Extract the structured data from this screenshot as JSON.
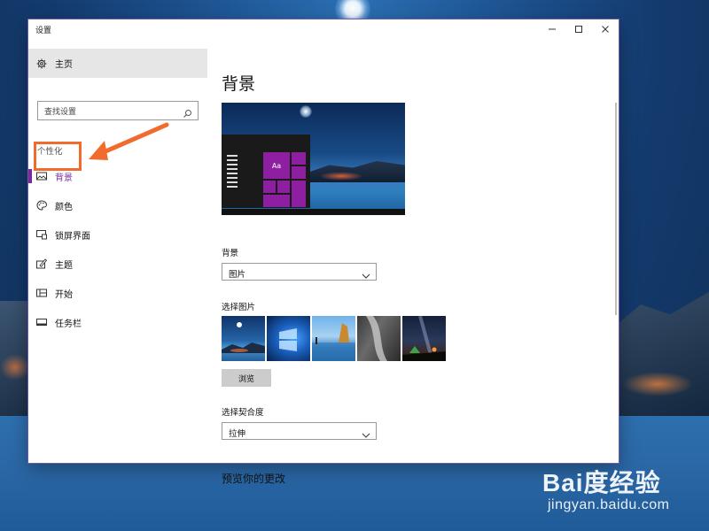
{
  "window": {
    "title": "设置"
  },
  "sidebar": {
    "home_label": "主页",
    "search_placeholder": "查找设置",
    "section_heading": "个性化",
    "items": [
      {
        "label": "背景",
        "icon": "picture-icon",
        "active": true
      },
      {
        "label": "颜色",
        "icon": "palette-icon",
        "active": false
      },
      {
        "label": "锁屏界面",
        "icon": "lock-screen-icon",
        "active": false
      },
      {
        "label": "主题",
        "icon": "theme-icon",
        "active": false
      },
      {
        "label": "开始",
        "icon": "start-icon",
        "active": false
      },
      {
        "label": "任务栏",
        "icon": "taskbar-icon",
        "active": false
      }
    ]
  },
  "main": {
    "title": "背景",
    "preview_tile_text": "Aa",
    "background_label": "背景",
    "background_value": "图片",
    "choose_picture_label": "选择图片",
    "browse_label": "浏览",
    "fit_label": "选择契合度",
    "fit_value": "拉伸",
    "preview_changes_label": "预览你的更改"
  },
  "watermark": {
    "logo": "Bai度经验",
    "site": "jingyan.baidu.com"
  },
  "colors": {
    "accent": "#7b2a9e",
    "annotation": "#f26b2e",
    "tile": "#8e1fa0"
  }
}
